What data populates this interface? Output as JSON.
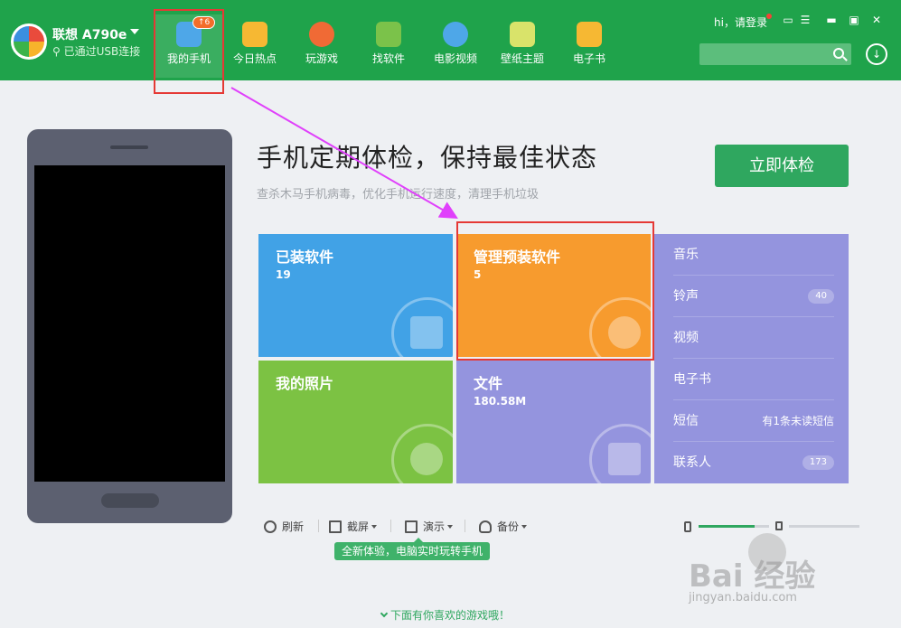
{
  "device": {
    "name": "联想 A790e",
    "status": "已通过USB连接"
  },
  "nav": [
    {
      "label": "我的手机",
      "badge": "6"
    },
    {
      "label": "今日热点"
    },
    {
      "label": "玩游戏"
    },
    {
      "label": "找软件"
    },
    {
      "label": "电影视频"
    },
    {
      "label": "壁纸主题"
    },
    {
      "label": "电子书"
    }
  ],
  "account": {
    "login": "hi，请登录"
  },
  "search": {
    "placeholder": "",
    "value": ""
  },
  "main": {
    "title": "手机定期体检，保持最佳状态",
    "subtitle": "查杀木马手机病毒，优化手机运行速度，清理手机垃圾",
    "check_button": "立即体检"
  },
  "tiles": {
    "installed": {
      "title": "已装软件",
      "count": "19"
    },
    "preinstalled": {
      "title": "管理预装软件",
      "count": "5"
    },
    "photos": {
      "title": "我的照片"
    },
    "files": {
      "title": "文件",
      "size": "180.58M"
    }
  },
  "side_list": [
    {
      "label": "音乐"
    },
    {
      "label": "铃声",
      "count": "40"
    },
    {
      "label": "视频"
    },
    {
      "label": "电子书"
    },
    {
      "label": "短信",
      "note": "有1条未读短信"
    },
    {
      "label": "联系人",
      "count": "173"
    }
  ],
  "toolbar": {
    "refresh": "刷新",
    "screenshot": "截屏",
    "demo": "演示",
    "backup": "备份"
  },
  "tooltip": "全新体验，电脑实时玩转手机",
  "storage": {
    "phone_used": 0.8,
    "sd_used": 0.0
  },
  "footer": {
    "more_games": "下面有你喜欢的游戏哦！"
  },
  "watermark": {
    "logo": "Bai 经验",
    "url": "jingyan.baidu.com"
  },
  "colors": {
    "header": "#1fa34b",
    "installed": "#41a2e6",
    "preinstalled": "#f79b2e",
    "photos": "#7cc243",
    "files": "#9494de",
    "highlight": "#e53935",
    "arrow": "#e040fb"
  }
}
